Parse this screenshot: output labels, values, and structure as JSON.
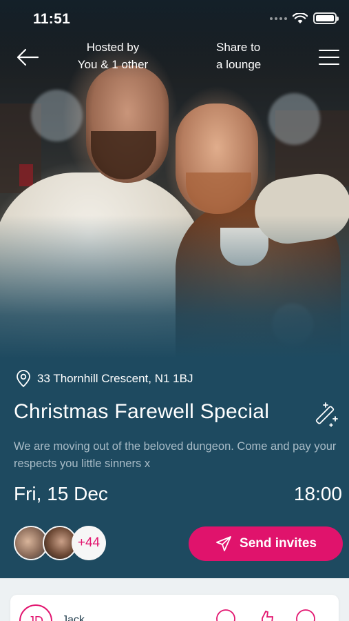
{
  "status_bar": {
    "time": "11:51"
  },
  "nav": {
    "hosted_line1": "Hosted by",
    "hosted_line2": "You & 1 other",
    "share_line1": "Share to",
    "share_line2": "a lounge"
  },
  "event": {
    "address": "33 Thornhill Crescent, N1 1BJ",
    "title": "Christmas Farewell Special",
    "description": "We are moving out of the beloved dungeon. Come and pay your respects you little sinners x",
    "date": "Fri, 15 Dec",
    "time": "18:00"
  },
  "guests": {
    "more_count": "+44"
  },
  "actions": {
    "send_invites": "Send invites"
  },
  "host_card": {
    "initials": "JD",
    "name": "Jack"
  },
  "colors": {
    "accent": "#e0136c",
    "background": "#1e4a60",
    "muted_text": "#a9bcc7"
  },
  "icons": {
    "back": "arrow-left-icon",
    "menu": "hamburger-menu-icon",
    "location": "location-pin-icon",
    "magic": "magic-wand-icon",
    "send": "paper-plane-icon"
  }
}
